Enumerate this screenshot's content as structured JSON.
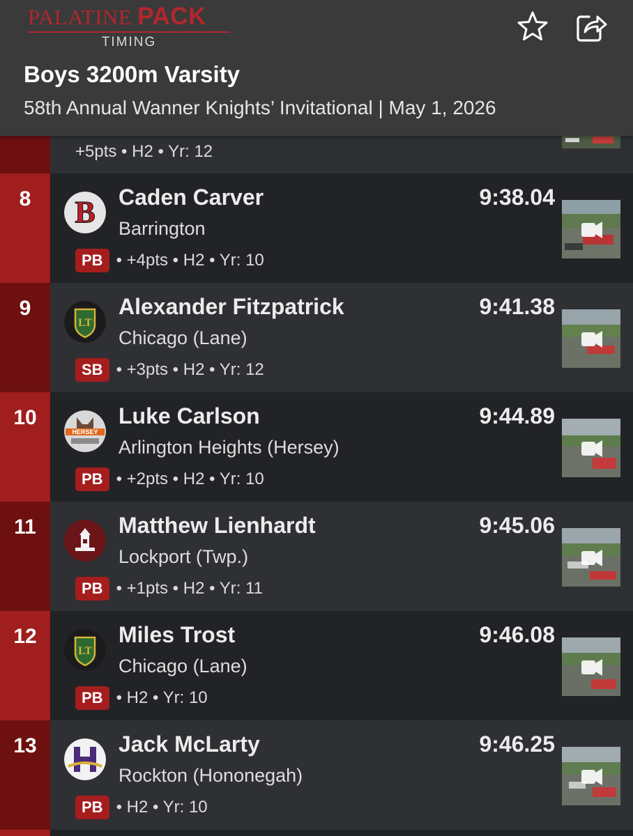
{
  "logo": {
    "word1": "PALATINE",
    "word2": "PACK",
    "sub": "TIMING"
  },
  "header": {
    "title": "Boys 3200m Varsity",
    "subtitle": "58th Annual Wanner Knights’ Invitational | May 1, 2026",
    "favorite_icon": "star-outline-icon",
    "share_icon": "share-icon"
  },
  "partial_row": {
    "meta": "+5pts • H2 • Yr: 12"
  },
  "results": [
    {
      "place": "8",
      "name": "Caden Carver",
      "school": "Barrington",
      "time": "9:38.04",
      "badge": "PB",
      "meta": "• +4pts • H2 • Yr: 10",
      "logo": "barrington-b"
    },
    {
      "place": "9",
      "name": "Alexander Fitzpatrick",
      "school": "Chicago (Lane)",
      "time": "9:41.38",
      "badge": "SB",
      "meta": "• +3pts • H2 • Yr: 12",
      "logo": "lane-shield"
    },
    {
      "place": "10",
      "name": "Luke Carlson",
      "school": "Arlington Heights (Hersey)",
      "time": "9:44.89",
      "badge": "PB",
      "meta": "• +2pts • H2 • Yr: 10",
      "logo": "hersey-husky"
    },
    {
      "place": "11",
      "name": "Matthew Lienhardt",
      "school": "Lockport (Twp.)",
      "time": "9:45.06",
      "badge": "PB",
      "meta": "• +1pts • H2 • Yr: 11",
      "logo": "lockport-tower"
    },
    {
      "place": "12",
      "name": "Miles Trost",
      "school": "Chicago (Lane)",
      "time": "9:46.08",
      "badge": "PB",
      "meta": "• H2 • Yr: 10",
      "logo": "lane-shield"
    },
    {
      "place": "13",
      "name": "Jack McLarty",
      "school": "Rockton (Hononegah)",
      "time": "9:46.25",
      "badge": "PB",
      "meta": "• H2 • Yr: 10",
      "logo": "hononegah-h"
    }
  ],
  "colors": {
    "header_bg": "#3a3a3b",
    "brand_red": "#b3262c",
    "place_red_a": "#a01e1e",
    "place_red_b": "#6e1010",
    "row_bg_a": "#222326",
    "row_bg_b": "#2e3034",
    "badge_red": "#a51d1d"
  }
}
